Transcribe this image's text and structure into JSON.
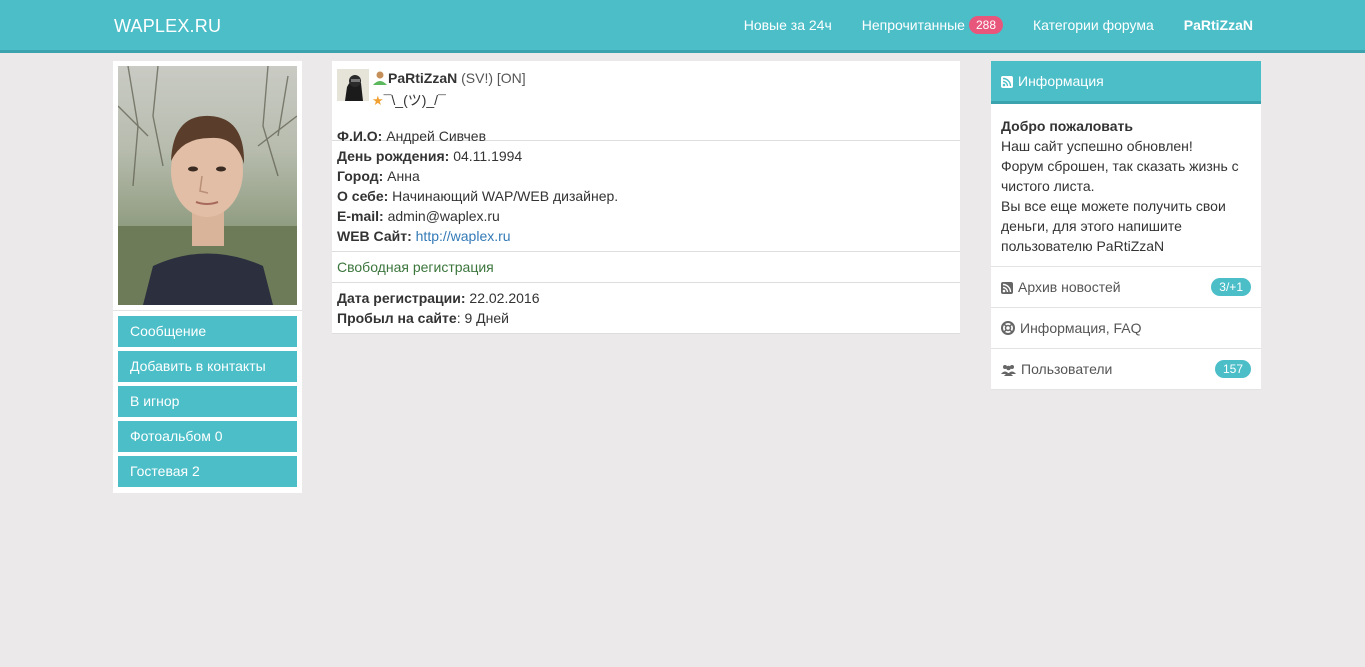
{
  "header": {
    "brand": "WAPLEX.RU",
    "nav": {
      "new24": "Новые за 24ч",
      "unread": "Непрочитанные",
      "unread_count": "288",
      "categories": "Категории форума",
      "user": "PaRtiZzaN"
    }
  },
  "sidebar": {
    "buttons": [
      {
        "label": "Сообщение"
      },
      {
        "label": "Добавить в контакты"
      },
      {
        "label": "В игнор"
      },
      {
        "label": "Фотоальбом 0"
      },
      {
        "label": "Гостевая 2"
      }
    ]
  },
  "profile": {
    "nick": "PaRtiZzaN",
    "tags": "(SV!) [ON]",
    "status": "¯\\_(ツ)_/¯",
    "fio_label": "Ф.И.О:",
    "fio": "Андрей Сивчев",
    "birthday_label": "День рождения:",
    "birthday": "04.11.1994",
    "city_label": "Город:",
    "city": "Анна",
    "about_label": "О себе:",
    "about": "Начинающий WAP/WEB дизайнер.",
    "email_label": "E-mail:",
    "email": "admin@waplex.ru",
    "web_label": "WEB Сайт:",
    "web": "http://waplex.ru",
    "registration": "Свободная регистрация",
    "regdate_label": "Дата регистрации:",
    "regdate": "22.02.2016",
    "stay_label": "Пробыл на сайте",
    "stay": ": 9 Дней"
  },
  "info": {
    "title": "Информация",
    "welcome": "Добро пожаловать",
    "lines": [
      "Наш сайт успешно обновлен!",
      "Форум сброшен, так сказать жизнь с",
      "чистого листа.",
      "Вы все еще можете получить свои",
      "деньги, для этого напишите",
      "пользователю PaRtiZzaN"
    ],
    "links": [
      {
        "label": "Архив новостей",
        "badge": "3/+1"
      },
      {
        "label": "Информация, FAQ"
      },
      {
        "label": "Пользователи",
        "badge": "157"
      }
    ]
  },
  "colors": {
    "accent": "#4bbec8",
    "accent_dark": "#3aa3ad",
    "badge_pink": "#e8567c",
    "link": "#337ab7",
    "green": "#3c763d"
  }
}
